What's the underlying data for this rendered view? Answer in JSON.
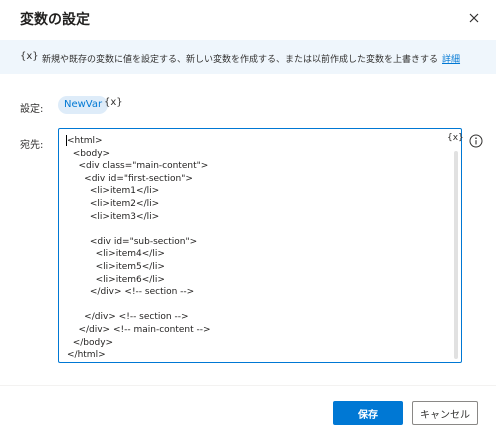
{
  "dialog": {
    "title": "変数の設定",
    "close_icon": "close-icon"
  },
  "info_bar": {
    "icon_text": "{x}",
    "text": "新規や既存の変数に値を設定する、新しい変数を作成する、または以前作成した変数を上書きする",
    "link": "詳細"
  },
  "set_field": {
    "label": "設定:",
    "variable": "NewVar",
    "fx_text": "{x}"
  },
  "to_field": {
    "label": "宛先:",
    "value": "<html>\n  <body>\n    <div class=\"main-content\">\n      <div id=\"first-section\">\n        <li>item1</li>\n        <li>item2</li>\n        <li>item3</li>\n\n        <div id=\"sub-section\">\n          <li>item4</li>\n          <li>item5</li>\n          <li>item6</li>\n        </div> <!-- section -->\n\n      </div> <!-- section -->\n    </div> <!-- main-content -->\n  </body>\n</html>",
    "fx_text": "{x}",
    "info_icon": "info-icon"
  },
  "buttons": {
    "save": "保存",
    "cancel": "キャンセル"
  },
  "colors": {
    "accent": "#0078d4",
    "info_bar_bg": "#eff6fc",
    "chip_bg": "#deecf9"
  }
}
